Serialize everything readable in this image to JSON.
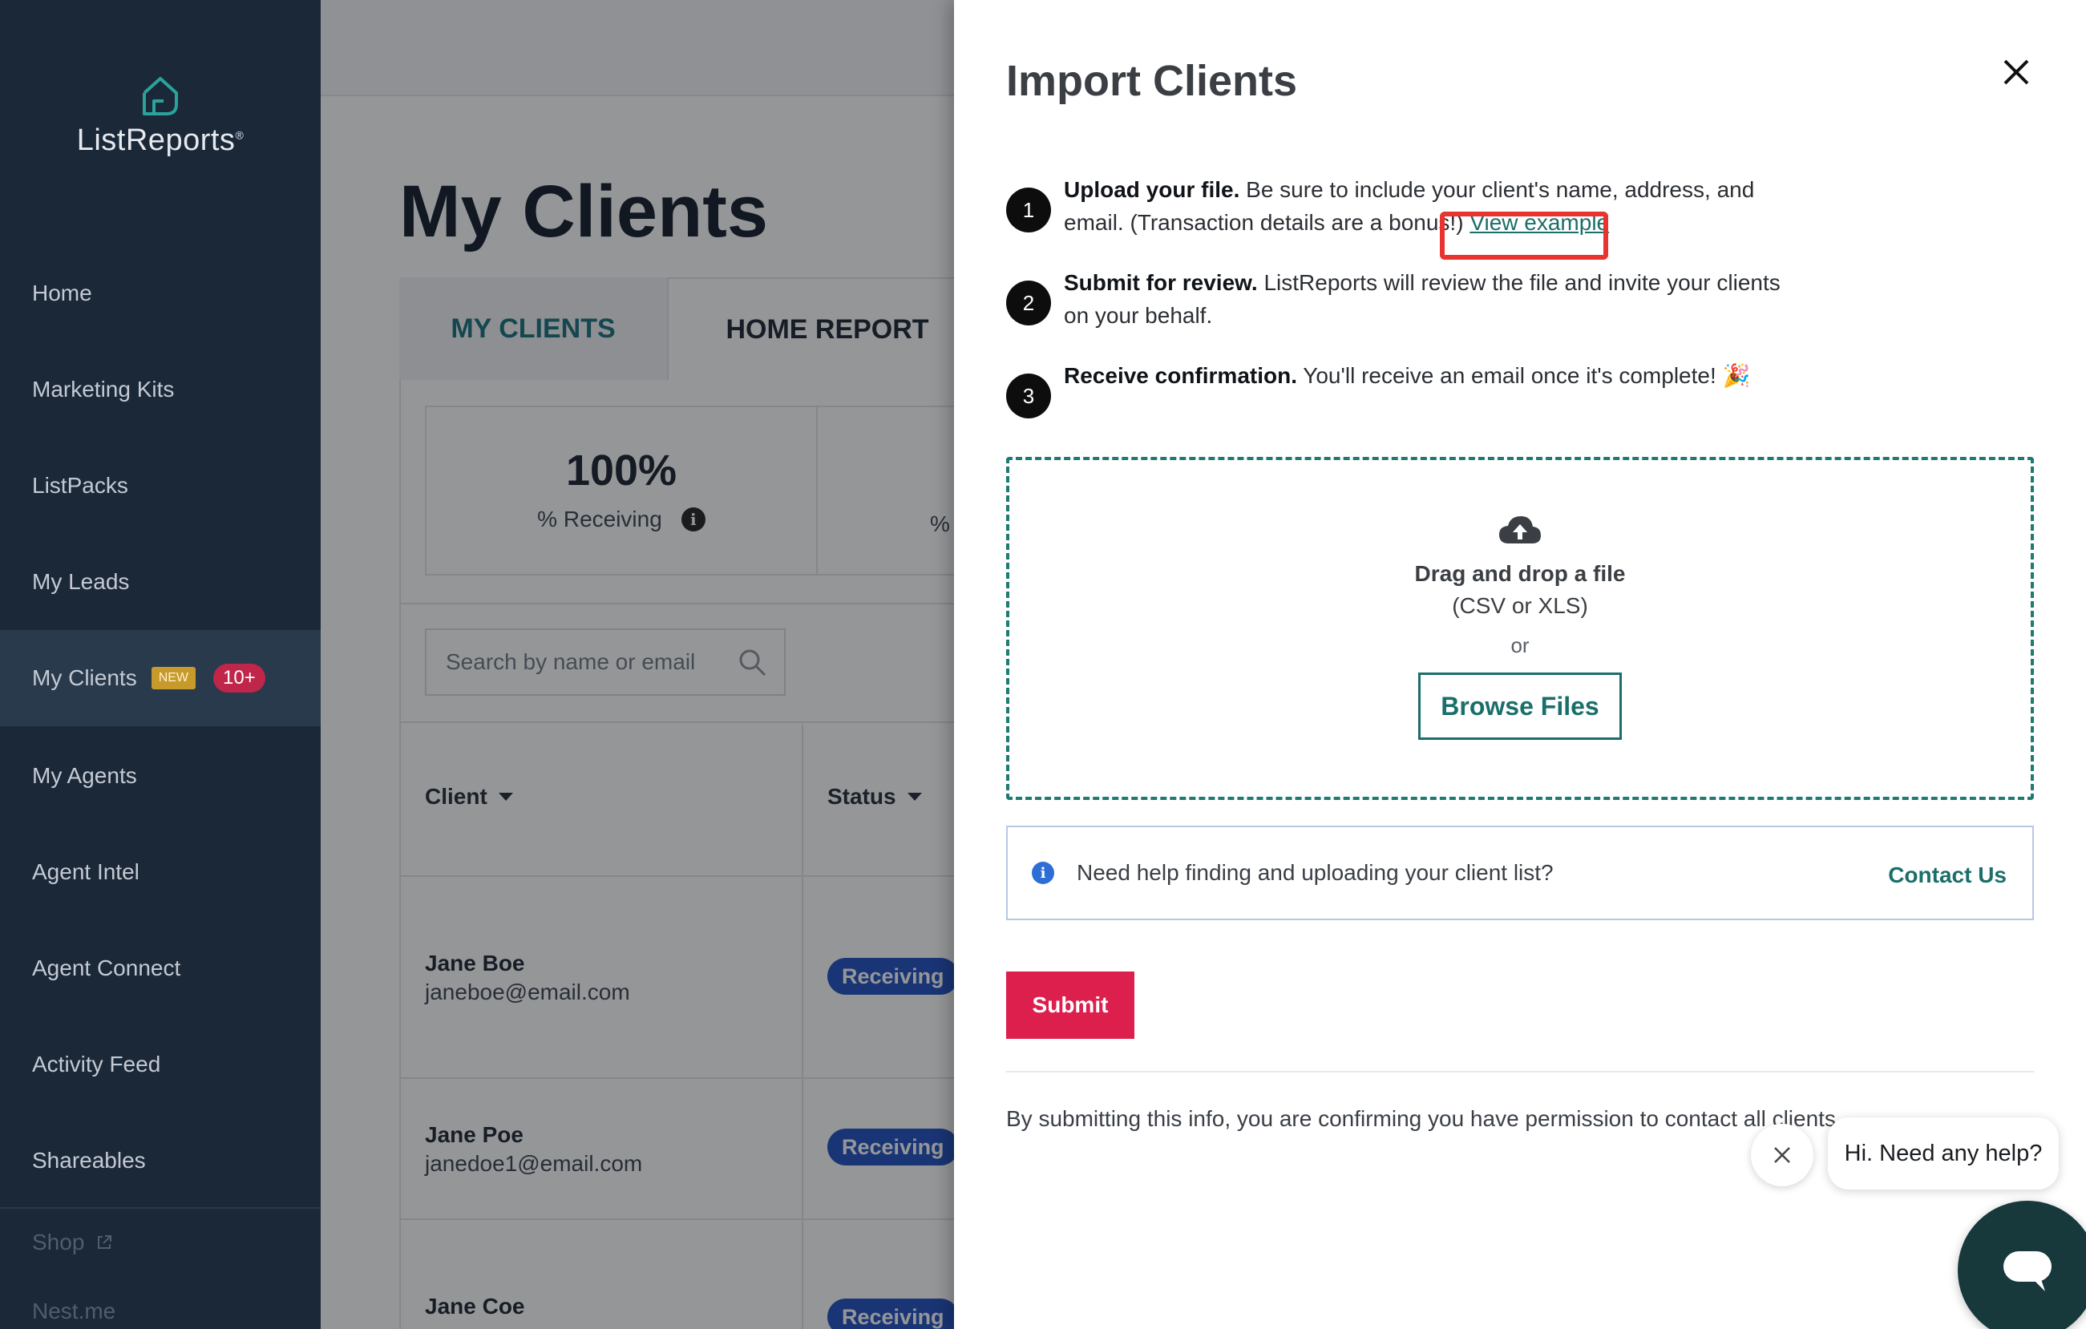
{
  "brand": {
    "name": "ListReports",
    "reg_mark": "®",
    "accent": "#1a6f6a"
  },
  "sidebar": {
    "items": [
      {
        "label": "Home"
      },
      {
        "label": "Marketing Kits"
      },
      {
        "label": "ListPacks"
      },
      {
        "label": "My Leads"
      },
      {
        "label": "My Clients",
        "badge_new": "NEW",
        "badge_count": "10+",
        "active": true
      },
      {
        "label": "My Agents"
      },
      {
        "label": "Agent Intel"
      },
      {
        "label": "Agent Connect"
      },
      {
        "label": "Activity Feed"
      },
      {
        "label": "Shareables"
      }
    ],
    "footer_items": [
      {
        "label": "Shop",
        "icon": "external-link-icon"
      },
      {
        "label": "Nest.me"
      }
    ]
  },
  "main": {
    "title": "My Clients",
    "tabs": [
      {
        "label": "MY CLIENTS"
      },
      {
        "label": "HOME REPORT",
        "active": true
      }
    ],
    "stats": [
      {
        "value": "100%",
        "label": "% Receiving"
      },
      {
        "label": "%"
      }
    ],
    "search": {
      "placeholder": "Search by name or email"
    },
    "table": {
      "columns": [
        "Client",
        "Status"
      ],
      "rows": [
        {
          "name": "Jane Boe",
          "email": "janeboe@email.com",
          "status": "Receiving"
        },
        {
          "name": "Jane Poe",
          "email": "janedoe1@email.com",
          "status": "Receiving"
        },
        {
          "name": "Jane Coe",
          "email": "",
          "status": "Receiving"
        }
      ]
    }
  },
  "modal": {
    "title": "Import Clients",
    "steps": [
      {
        "num": "1",
        "bold": "Upload your file.",
        "text": " Be sure to include your client's name, address, and email. (Transaction details are a bonus!) ",
        "link": "View example"
      },
      {
        "num": "2",
        "bold": "Submit for review.",
        "text": " ListReports will review the file and invite your clients on your behalf."
      },
      {
        "num": "3",
        "bold": "Receive confirmation.",
        "text": " You'll receive an email once it's complete! 🎉"
      }
    ],
    "dropzone": {
      "title": "Drag and drop a file",
      "subtitle": "(CSV or XLS)",
      "or": "or",
      "browse_label": "Browse Files"
    },
    "help": {
      "text": "Need help finding and uploading your client list?",
      "link": "Contact Us"
    },
    "submit_label": "Submit",
    "disclaimer": "By submitting this info, you are confirming you have permission to contact all clients."
  },
  "chat": {
    "bubble": "Hi. Need any help?"
  },
  "colors": {
    "sidebar_bg": "#1b2838",
    "submit": "#dc1f4c",
    "status_pill": "#1f4fbf",
    "highlight": "#e8332e"
  }
}
